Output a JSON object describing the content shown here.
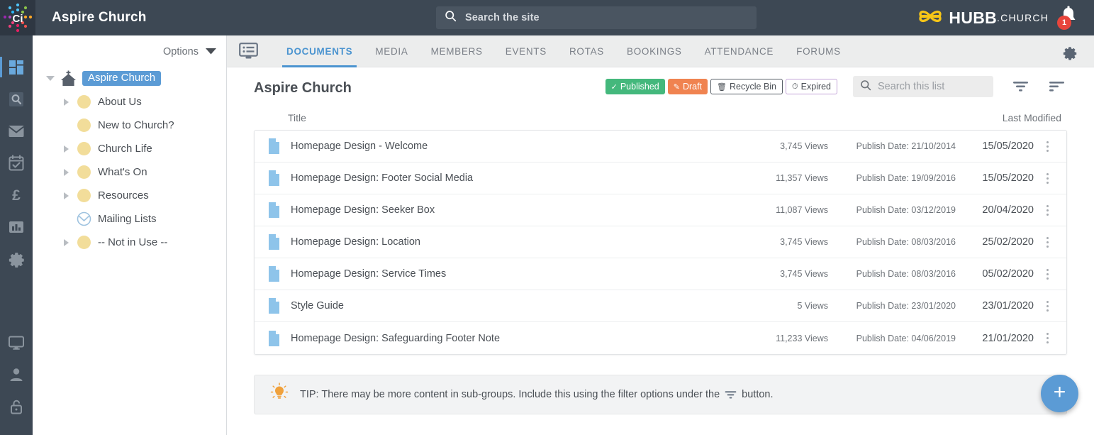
{
  "header": {
    "app_title": "Aspire Church",
    "search": {
      "placeholder": "Search the site",
      "icon": "search-icon"
    },
    "brand_name": "HUBB",
    "brand_suffix": ".CHURCH",
    "notification_count": "1",
    "bell_icon": "bell-icon",
    "logo_icon": "ci-logo-icon"
  },
  "rail": {
    "items": [
      {
        "name": "dashboard-icon",
        "label": "Dashboard",
        "active": true
      },
      {
        "name": "search-icon",
        "label": "Search",
        "active": false
      },
      {
        "name": "mail-icon",
        "label": "Mail",
        "active": false
      },
      {
        "name": "calendar-check-icon",
        "label": "Calendar",
        "active": false
      },
      {
        "name": "pound-icon",
        "label": "Giving",
        "active": false
      },
      {
        "name": "bar-chart-icon",
        "label": "Reports",
        "active": false
      },
      {
        "name": "gear-icon",
        "label": "Settings",
        "active": false
      }
    ],
    "bottom_items": [
      {
        "name": "monitor-icon",
        "label": "Website"
      },
      {
        "name": "person-icon",
        "label": "Account"
      },
      {
        "name": "unlock-icon",
        "label": "Log out"
      }
    ]
  },
  "tree": {
    "options_label": "Options",
    "nodes": [
      {
        "label": "Aspire Church",
        "icon": "church-home-icon",
        "caret": "down",
        "level": 1,
        "selected": true
      },
      {
        "label": "About Us",
        "icon": "folder-dot-icon",
        "caret": "right",
        "level": 2,
        "selected": false
      },
      {
        "label": "New to Church?",
        "icon": "folder-dot-icon",
        "caret": "none",
        "level": 2,
        "selected": false
      },
      {
        "label": "Church Life",
        "icon": "folder-dot-icon",
        "caret": "right",
        "level": 2,
        "selected": false
      },
      {
        "label": "What's On",
        "icon": "folder-dot-icon",
        "caret": "right",
        "level": 2,
        "selected": false
      },
      {
        "label": "Resources",
        "icon": "folder-dot-icon",
        "caret": "right",
        "level": 2,
        "selected": false
      },
      {
        "label": "Mailing Lists",
        "icon": "mailing-list-icon",
        "caret": "none",
        "level": 2,
        "selected": false
      },
      {
        "label": "-- Not in Use --",
        "icon": "folder-dot-icon",
        "caret": "right",
        "level": 2,
        "selected": false
      }
    ]
  },
  "tabs": {
    "left_icon": "list-view-icon",
    "gear_icon": "gear-icon",
    "items": [
      {
        "label": "DOCUMENTS",
        "active": true
      },
      {
        "label": "MEDIA",
        "active": false
      },
      {
        "label": "MEMBERS",
        "active": false
      },
      {
        "label": "EVENTS",
        "active": false
      },
      {
        "label": "ROTAS",
        "active": false
      },
      {
        "label": "BOOKINGS",
        "active": false
      },
      {
        "label": "ATTENDANCE",
        "active": false
      },
      {
        "label": "FORUMS",
        "active": false
      }
    ]
  },
  "main": {
    "page_title": "Aspire Church",
    "filters": [
      {
        "label": "Published",
        "icon": "check-icon",
        "style": "published"
      },
      {
        "label": "Draft",
        "icon": "pencil-icon",
        "style": "draft"
      },
      {
        "label": "Recycle Bin",
        "icon": "trash-icon",
        "style": "recycle"
      },
      {
        "label": "Expired",
        "icon": "clock-icon",
        "style": "expired"
      }
    ],
    "list_search_placeholder": "Search this list",
    "filter_icon": "filter-icon",
    "sort_icon": "sort-icon",
    "columns": {
      "title": "Title",
      "last_modified": "Last Modified"
    },
    "rows": [
      {
        "title": "Homepage Design - Welcome",
        "views": "3,745 Views",
        "publish": "Publish Date: 21/10/2014",
        "modified": "15/05/2020"
      },
      {
        "title": "Homepage Design: Footer Social Media",
        "views": "11,357 Views",
        "publish": "Publish Date: 19/09/2016",
        "modified": "15/05/2020"
      },
      {
        "title": "Homepage Design: Seeker Box",
        "views": "11,087 Views",
        "publish": "Publish Date: 03/12/2019",
        "modified": "20/04/2020"
      },
      {
        "title": "Homepage Design: Location",
        "views": "3,745 Views",
        "publish": "Publish Date: 08/03/2016",
        "modified": "25/02/2020"
      },
      {
        "title": "Homepage Design: Service Times",
        "views": "3,745 Views",
        "publish": "Publish Date: 08/03/2016",
        "modified": "05/02/2020"
      },
      {
        "title": "Style Guide",
        "views": "5 Views",
        "publish": "Publish Date: 23/01/2020",
        "modified": "23/01/2020"
      },
      {
        "title": "Homepage Design: Safeguarding Footer Note",
        "views": "11,233 Views",
        "publish": "Publish Date: 04/06/2019",
        "modified": "21/01/2020"
      }
    ],
    "tip_prefix": "TIP: There may be more content in sub-groups. Include this using the filter options under the",
    "tip_suffix": "button.",
    "tip_icon": "lightbulb-icon",
    "fab_label": "+"
  },
  "colors": {
    "topbar": "#3d4854",
    "accent_blue": "#5b9bd5",
    "tab_active": "#4b94d0",
    "published_green": "#44b87c",
    "draft_orange": "#f08350",
    "expired_border": "#c3a4d8",
    "folder_yellow": "#f2dd9a",
    "brand_yellow": "#f5c518",
    "badge_red": "#e8453c"
  }
}
